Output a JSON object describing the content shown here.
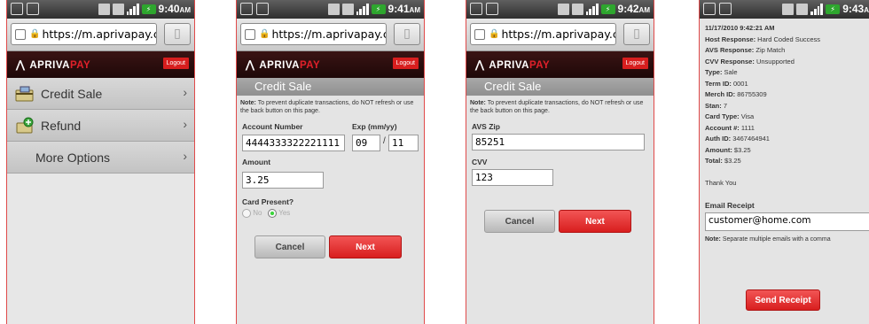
{
  "screens": [
    {
      "time": "9:40",
      "ampm": "AM",
      "url": "https://m.aprivapay.c..."
    },
    {
      "time": "9:41",
      "ampm": "AM",
      "url": "https://m.aprivapay.c..."
    },
    {
      "time": "9:42",
      "ampm": "AM",
      "url": "https://m.aprivapay.c..."
    },
    {
      "time": "9:43",
      "ampm": "A",
      "url": ""
    }
  ],
  "brand": {
    "apriva": "APRIVA",
    "pay": "PAY",
    "logout": "Logout"
  },
  "menu": {
    "items": [
      {
        "label": "Credit Sale"
      },
      {
        "label": "Refund"
      },
      {
        "label": "More Options"
      }
    ]
  },
  "credit_sale": {
    "title": "Credit Sale",
    "note": "Note: To prevent duplicate transactions, do NOT refresh or use the back button on this page.",
    "note_bold": "Note:",
    "note_text": " To prevent duplicate transactions, do NOT refresh or use the back button on this page.",
    "account_label": "Account Number",
    "account_value": "4444333322221111",
    "exp_label": "Exp (mm/yy)",
    "exp_month": "09",
    "exp_sep": "/",
    "exp_year": "11",
    "amount_label": "Amount",
    "amount_value": "3.25",
    "card_present_label": "Card Present?",
    "no_label": "No",
    "yes_label": "Yes",
    "cancel": "Cancel",
    "next": "Next"
  },
  "avs": {
    "title": "Credit Sale",
    "avs_label": "AVS Zip",
    "avs_value": "85251",
    "cvv_label": "CVV",
    "cvv_value": "123",
    "cancel": "Cancel",
    "next": "Next"
  },
  "receipt": {
    "timestamp": "11/17/2010 9:42:21 AM",
    "lines": [
      {
        "k": "Host Response:",
        "v": " Hard Coded Success"
      },
      {
        "k": "AVS Response:",
        "v": " Zip Match"
      },
      {
        "k": "CVV Response:",
        "v": " Unsupported"
      },
      {
        "k": "Type:",
        "v": " Sale"
      },
      {
        "k": "Term ID:",
        "v": " 0001"
      },
      {
        "k": "Merch ID:",
        "v": " 86755309"
      },
      {
        "k": "Stan:",
        "v": " 7"
      },
      {
        "k": "Card Type:",
        "v": " Visa"
      },
      {
        "k": "Account #:",
        "v": " 1111"
      },
      {
        "k": "Auth ID:",
        "v": " 3467464941"
      },
      {
        "k": "Amount:",
        "v": " $3.25"
      },
      {
        "k": "Total:",
        "v": " $3.25"
      }
    ],
    "thanks": "Thank You",
    "email_label": "Email Receipt",
    "email_value": "customer@home.com",
    "email_note_bold": "Note:",
    "email_note": " Separate multiple emails with a comma",
    "send": "Send Receipt"
  }
}
